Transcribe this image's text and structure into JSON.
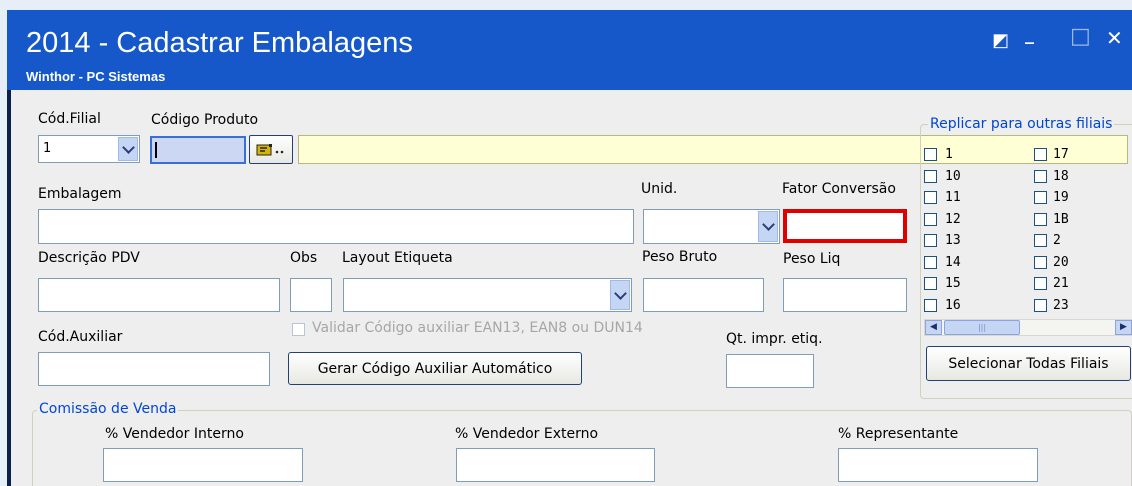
{
  "window": {
    "title": "2014 - Cadastrar Embalagens",
    "subtitle": "Winthor - PC Sistemas",
    "controls": {
      "restore": "◩",
      "minimize": "_",
      "maximize": "□",
      "close": "✕"
    }
  },
  "fields": {
    "cod_filial": {
      "label": "Cód.Filial",
      "value": "1"
    },
    "codigo_produto": {
      "label": "Código Produto",
      "value": ""
    },
    "descricao_produto": {
      "value": ""
    },
    "embalagem": {
      "label": "Embalagem",
      "value": ""
    },
    "unid": {
      "label": "Unid.",
      "value": ""
    },
    "fator_conversao": {
      "label": "Fator Conversão",
      "value": ""
    },
    "descricao_pdv": {
      "label": "Descrição PDV",
      "value": ""
    },
    "obs": {
      "label": "Obs",
      "value": ""
    },
    "layout_etiqueta": {
      "label": "Layout Etiqueta",
      "value": ""
    },
    "peso_bruto": {
      "label": "Peso Bruto",
      "value": ""
    },
    "peso_liq": {
      "label": "Peso Liq",
      "value": ""
    },
    "cod_auxiliar": {
      "label": "Cód.Auxiliar",
      "value": ""
    },
    "validar_ean": {
      "label": "Validar Código auxiliar EAN13, EAN8 ou DUN14",
      "checked": false,
      "disabled": true
    },
    "gerar_button": {
      "label": "Gerar Código Auxiliar Automático"
    },
    "qt_impr": {
      "label": "Qt. impr. etiq.",
      "value": ""
    }
  },
  "replicar": {
    "legend": "Replicar para outras filiais",
    "col1": [
      "1",
      "10",
      "11",
      "12",
      "13",
      "14",
      "15",
      "16"
    ],
    "col2": [
      "17",
      "18",
      "19",
      "1B",
      "2",
      "20",
      "21",
      "23"
    ],
    "select_all_button": "Selecionar Todas Filiais",
    "scroll_thumb_grip": "|||"
  },
  "comissao": {
    "legend": "Comissão de Venda",
    "vendedor_interno": {
      "label": "% Vendedor Interno",
      "value": ""
    },
    "vendedor_externo": {
      "label": "% Vendedor Externo",
      "value": ""
    },
    "representante": {
      "label": "% Representante",
      "value": ""
    }
  },
  "colors": {
    "titlebar": "#1658c9",
    "highlight_border": "#e00000",
    "legend_text": "#0046d5",
    "readonly_field": "#ffffd5"
  }
}
